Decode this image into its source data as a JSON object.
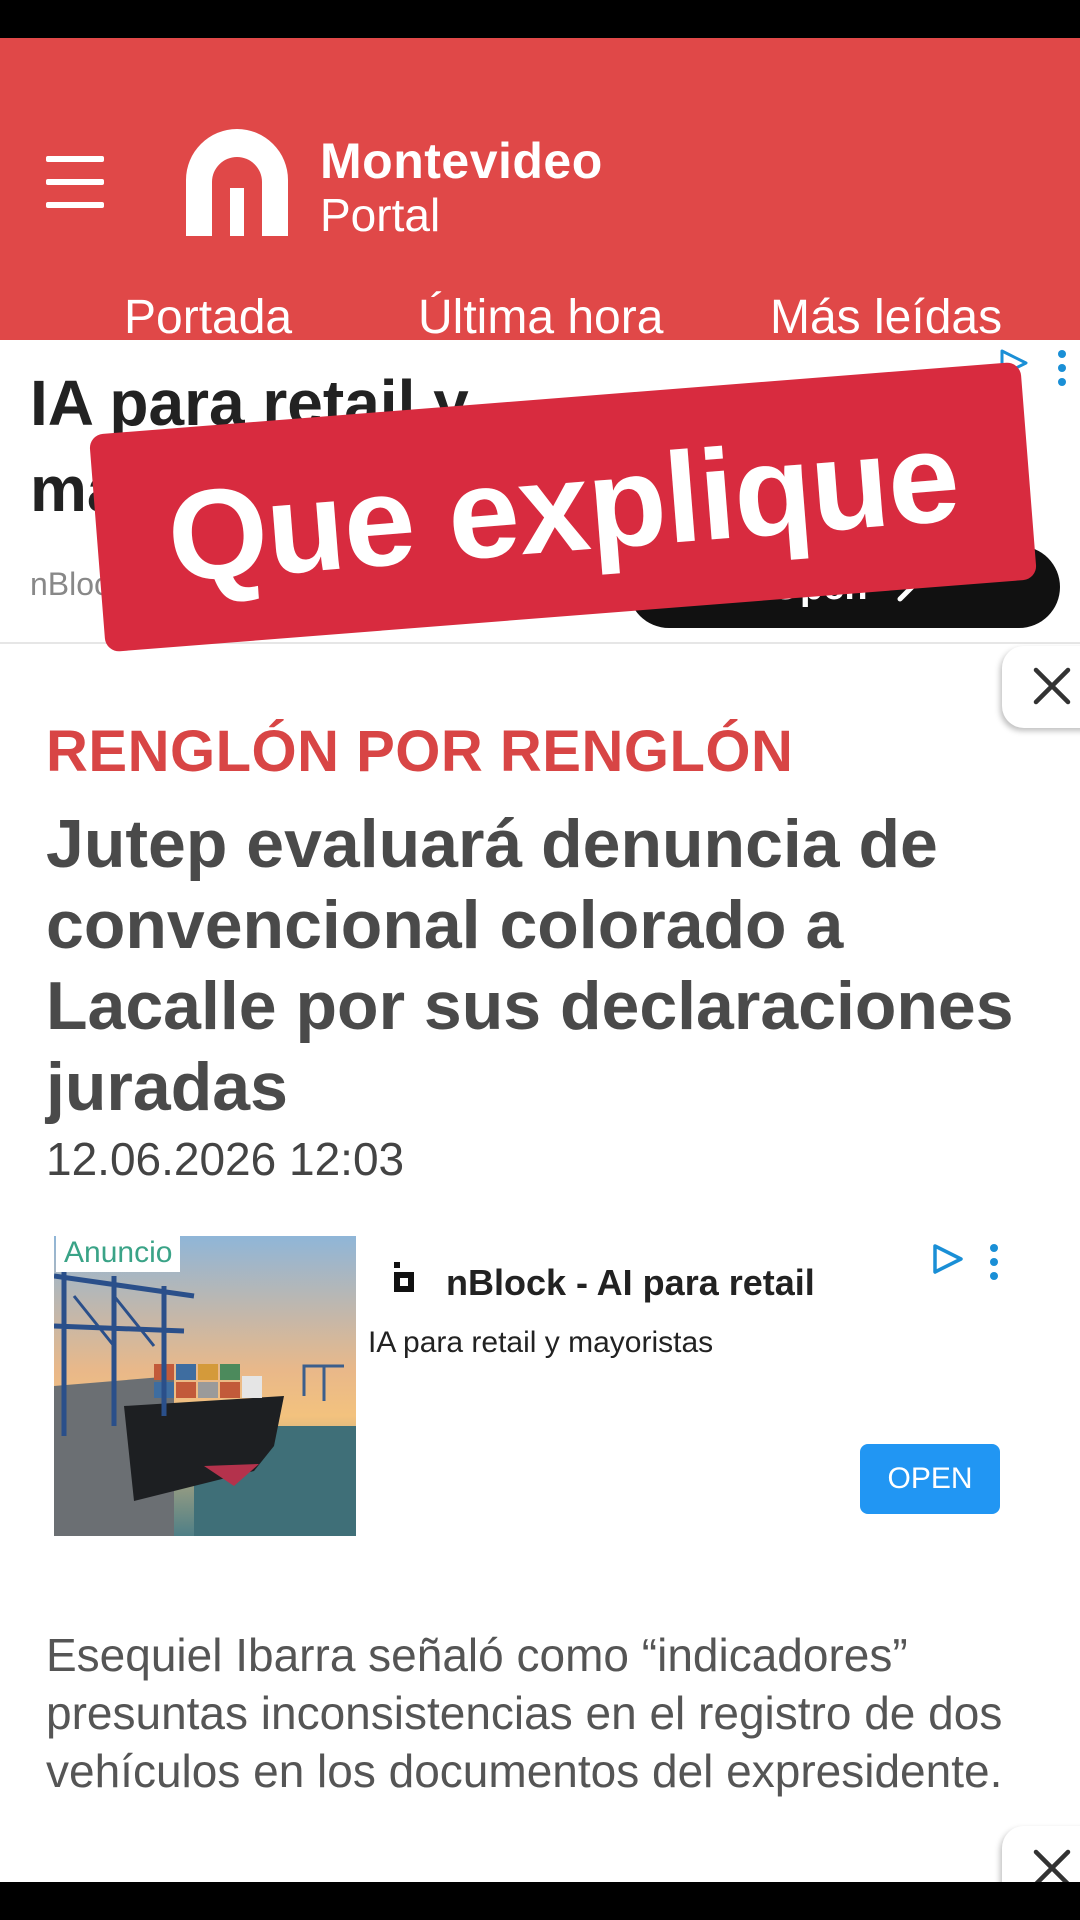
{
  "header": {
    "logo_line1": "Montevideo",
    "logo_line2": "Portal",
    "nav": [
      "Portada",
      "Última hora",
      "Más leídas"
    ]
  },
  "top_ad": {
    "title": "IA para retail y mayoristas",
    "source": "nBlock",
    "button": "Open"
  },
  "overlay_caption": "Que explique",
  "article": {
    "kicker": "RENGLÓN POR RENGLÓN",
    "headline": "Jutep evaluará denuncia de convencional colorado a Lacalle por sus declaraciones juradas",
    "date": "12.06.2026 12:03",
    "body": "Esequiel Ibarra señaló como “indicadores” presuntas inconsistencias en el registro de dos vehículos en los documentos del expresidente."
  },
  "inline_ad": {
    "label": "Anuncio",
    "advertiser": "nBlock - AI para retail",
    "tagline": "IA para retail y mayoristas",
    "button": "OPEN"
  },
  "colors": {
    "brand_red": "#e04848",
    "kicker_red": "#d84545",
    "sticker_red": "#d82b3f",
    "ad_button_blue": "#2196f3"
  },
  "icons": [
    "menu-icon",
    "logo-mark-icon",
    "adchoices-icon",
    "more-options-icon",
    "close-icon",
    "chevron-right-icon",
    "nblock-logo-icon"
  ]
}
